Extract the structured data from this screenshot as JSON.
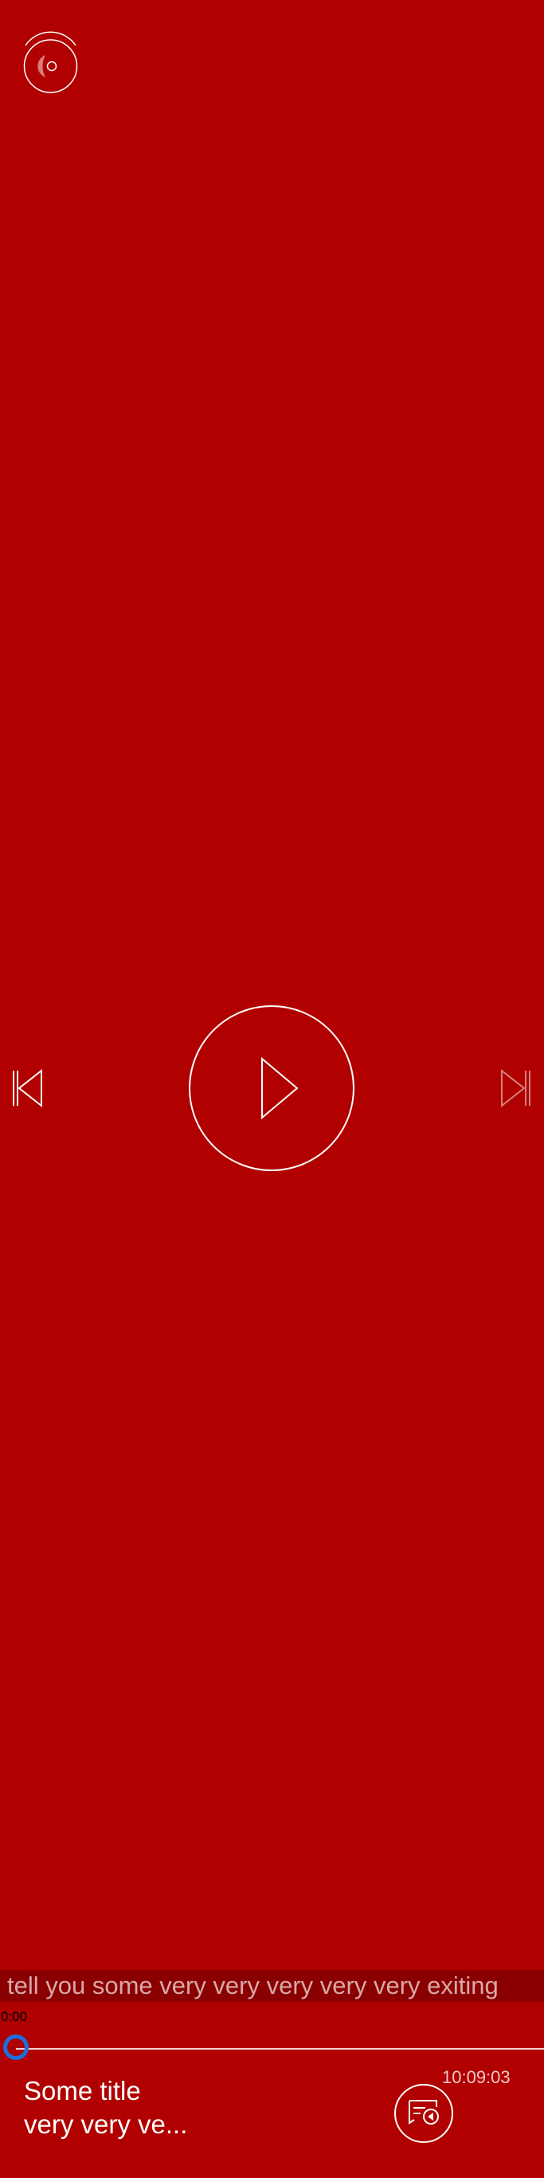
{
  "player": {
    "ticker_text": "tell you some very very very very very exiting",
    "elapsed_time": "0:00",
    "total_time": "10:09:03",
    "progress": 0,
    "title": "Some title",
    "subtitle": "very very ve..."
  },
  "controls": {
    "top_button_icon": "disc-icon",
    "prev_icon": "skip-previous-icon",
    "play_icon": "play-icon",
    "next_icon": "skip-next-icon",
    "playlist_icon": "playlist-icon",
    "next_enabled": false
  },
  "colors": {
    "background": "#b00000",
    "ticker_background": "#8a0000",
    "seek_thumb": "#1e6fd9",
    "foreground": "#ffffff"
  }
}
